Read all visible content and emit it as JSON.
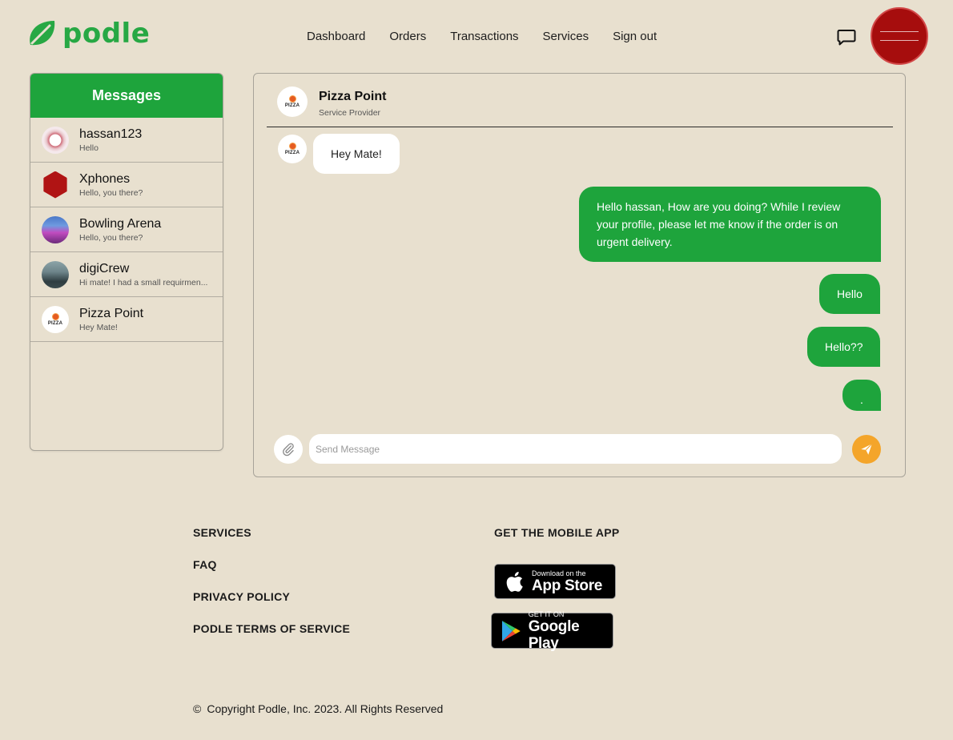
{
  "brand": {
    "name": "podle",
    "color": "#27a844"
  },
  "nav": {
    "items": [
      {
        "label": "Dashboard"
      },
      {
        "label": "Orders"
      },
      {
        "label": "Transactions"
      },
      {
        "label": "Services"
      },
      {
        "label": "Sign out"
      }
    ]
  },
  "sidebar": {
    "title": "Messages",
    "conversations": [
      {
        "name": "hassan123",
        "last": "Hello",
        "avatar": "hassan-avatar"
      },
      {
        "name": "Xphones",
        "last": "Hello, you there?",
        "avatar": "xphones-avatar"
      },
      {
        "name": "Bowling Arena",
        "last": "Hello, you there?",
        "avatar": "bowling-avatar"
      },
      {
        "name": "digiCrew",
        "last": "Hi mate! I had a small requirmen...",
        "avatar": "digicrew-avatar"
      },
      {
        "name": "Pizza Point",
        "last": "Hey Mate!",
        "avatar": "pizza-avatar"
      }
    ]
  },
  "chat": {
    "title": "Pizza Point",
    "subtitle": "Service Provider",
    "avatar_text": "PIZZA",
    "messages": [
      {
        "from": "them",
        "text": "Hey Mate!"
      },
      {
        "from": "me",
        "text": "Hello hassan, How are you doing? While I review your profile, please let me know if the order is on urgent delivery."
      },
      {
        "from": "me",
        "text": "Hello"
      },
      {
        "from": "me",
        "text": "Hello??"
      },
      {
        "from": "me",
        "text": "."
      }
    ],
    "composer": {
      "placeholder": "Send Message"
    },
    "colors": {
      "outgoing": "#1ea43c",
      "incoming": "#ffffff",
      "send": "#f4a52a"
    }
  },
  "footer": {
    "links": [
      {
        "label": "SERVICES"
      },
      {
        "label": "FAQ"
      },
      {
        "label": "PRIVACY POLICY"
      },
      {
        "label": "PODLE TERMS OF SERVICE"
      }
    ],
    "app_title": "GET THE MOBILE APP",
    "app_store": {
      "small": "Download on the",
      "big": "App Store"
    },
    "google_play": {
      "small": "GET IT ON",
      "big": "Google Play"
    },
    "copyright_symbol": "©",
    "copyright": "Copyright Podle, Inc. 2023. All Rights Reserved"
  }
}
